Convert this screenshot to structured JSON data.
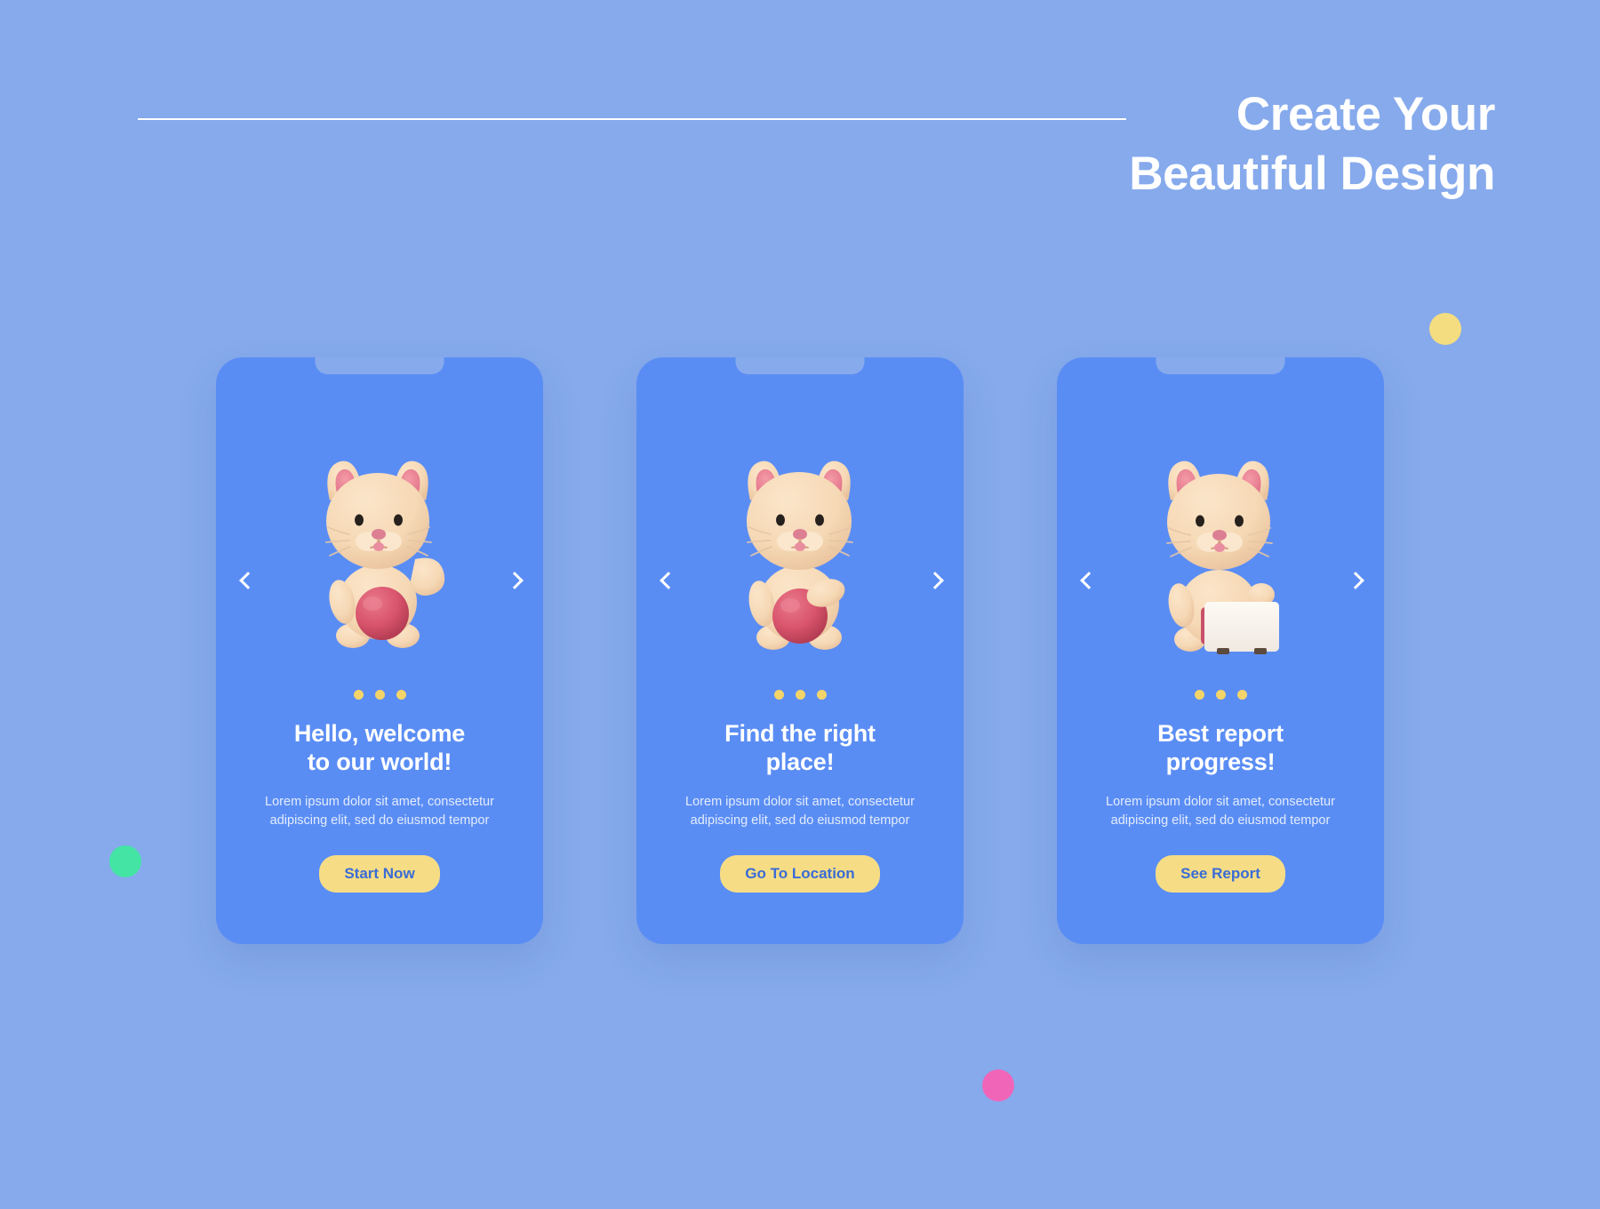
{
  "theme": {
    "background_color": "#86aaec",
    "card_color": "#5a8df4",
    "accent_color": "#f6dd85",
    "button_text_color": "#3a6cd6",
    "heading_color": "#ffffff"
  },
  "header": {
    "title_lines": [
      "Create Your",
      "Beautiful Design"
    ],
    "divider": "horizontal-rule"
  },
  "decorations": [
    {
      "name": "yellow-dot",
      "color": "#f4dd80"
    },
    {
      "name": "green-dot",
      "color": "#44e4a4"
    },
    {
      "name": "pink-dot",
      "color": "#f165b9"
    }
  ],
  "carousel": {
    "prev_icon": "chevron-left-icon",
    "next_icon": "chevron-right-icon",
    "indicator_count": 3,
    "slides": [
      {
        "illustration": "cat-waving-with-ball",
        "title_line1": "Hello, welcome",
        "title_line2": "to our world!",
        "body_line1": "Lorem ipsum dolor sit amet, consectetur",
        "body_line2": "adipiscing elit, sed do eiusmod tempor",
        "cta_label": "Start Now"
      },
      {
        "illustration": "cat-holding-ball",
        "title_line1": "Find the right",
        "title_line2": "place!",
        "body_line1": "Lorem ipsum dolor sit amet, consectetur",
        "body_line2": "adipiscing elit, sed do eiusmod tempor",
        "cta_label": "Go To Location"
      },
      {
        "illustration": "cat-holding-board",
        "title_line1": "Best report",
        "title_line2": "progress!",
        "body_line1": "Lorem ipsum dolor sit amet, consectetur",
        "body_line2": "adipiscing elit, sed do eiusmod tempor",
        "cta_label": "See Report"
      }
    ]
  }
}
